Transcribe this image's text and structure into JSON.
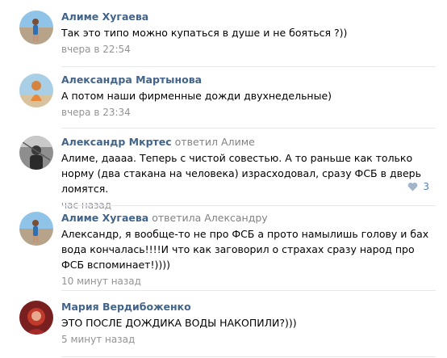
{
  "comments": [
    {
      "author": "Алиме Хугаева",
      "reply_label": "",
      "reply_target": "",
      "text": "Так это типо можно купаться в душе и не бояться ?))",
      "time": "вчера в 22:54",
      "likes": ""
    },
    {
      "author": "Александра Мартынова",
      "reply_label": "",
      "reply_target": "",
      "text": "А потом наши фирменные дожди двухнедельные)",
      "time": "вчера в 23:34",
      "likes": ""
    },
    {
      "author": "Александр Мкртес",
      "reply_label": "ответил",
      "reply_target": "Алиме",
      "text": "Алиме, даааа. Теперь с чистой совестью. А то раньше как только норму (два стакана на человека) израсходовал, сразу ФСБ в дверь ломятся.",
      "time": "час назад",
      "likes": "3"
    },
    {
      "author": "Алиме Хугаева",
      "reply_label": "ответила",
      "reply_target": "Александру",
      "text": "Александр, я вообще-то не про ФСБ а прото намылишь голову и бах вода кончалась!!!!И что как заговорил о страхах сразу народ про ФСБ вспоминает!))))",
      "time": "10 минут назад",
      "likes": ""
    },
    {
      "author": "Мария Вердибоженко",
      "reply_label": "",
      "reply_target": "",
      "text": "ЭТО ПОСЛЕ ДОЖДИКА ВОДЫ НАКОПИЛИ?)))",
      "time": "5 минут назад",
      "likes": ""
    }
  ],
  "icons": {
    "like": "heart-icon",
    "avatar": "user-avatar"
  },
  "colors": {
    "author": "#42648b",
    "meta": "#939393",
    "like": "#5181b8",
    "divider": "#e7e8ec"
  }
}
